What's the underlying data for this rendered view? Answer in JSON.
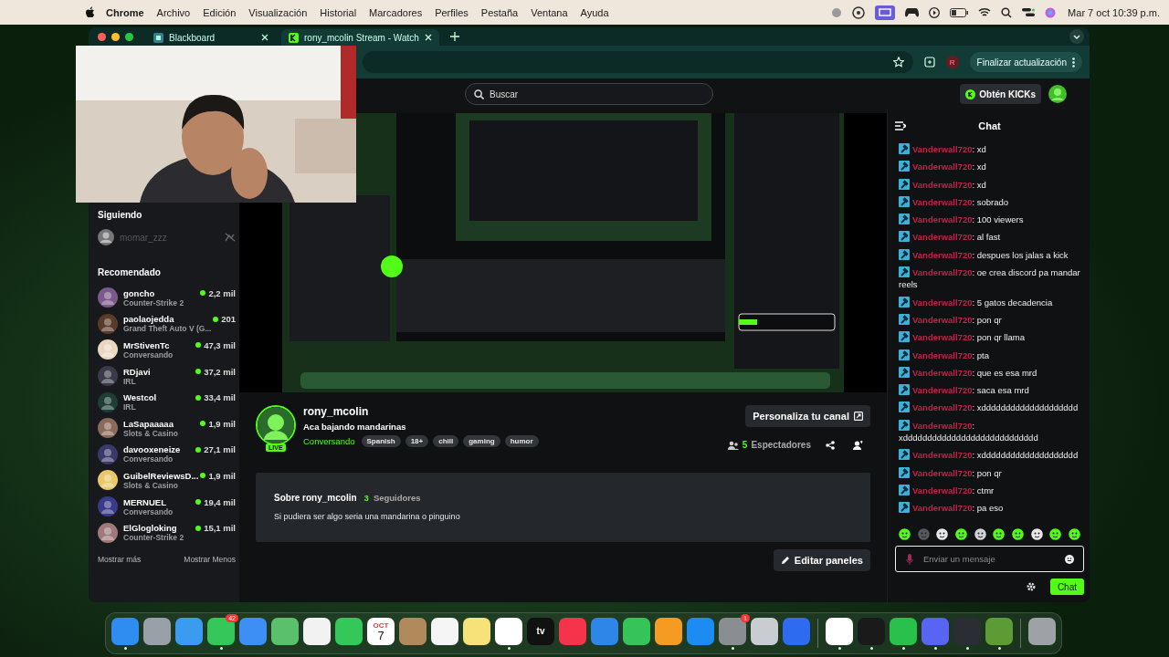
{
  "menu_bar": {
    "app": "Chrome",
    "menus": [
      "Archivo",
      "Edición",
      "Visualización",
      "Historial",
      "Marcadores",
      "Perfiles",
      "Pestaña",
      "Ventana",
      "Ayuda"
    ],
    "clock": "Mar 7 oct 10:39 p.m."
  },
  "browser": {
    "tabs": [
      {
        "title": "Blackboard",
        "selected": false
      },
      {
        "title": "rony_mcolin Stream - Watch",
        "selected": true
      }
    ],
    "profile_initial": "R",
    "update_button": "Finalizar actualización"
  },
  "header": {
    "search": {
      "placeholder": "Buscar"
    },
    "kicks_button": "Obtén KICKs"
  },
  "sidebar": {
    "following_title": "Siguiendo",
    "following": [
      {
        "name": "momar_zzz",
        "live": false
      }
    ],
    "recommended_title": "Recomendado",
    "recommended": [
      {
        "name": "goncho",
        "category": "Counter-Strike 2",
        "viewers": "2,2 mil"
      },
      {
        "name": "paolaojedda",
        "category": "Grand Theft Auto V (G...",
        "viewers": "201"
      },
      {
        "name": "MrStivenTc",
        "category": "Conversando",
        "viewers": "47,3 mil"
      },
      {
        "name": "RDjavi",
        "category": "IRL",
        "viewers": "37,2 mil"
      },
      {
        "name": "Westcol",
        "category": "IRL",
        "viewers": "33,4 mil"
      },
      {
        "name": "LaSapaaaaa",
        "category": "Slots & Casino",
        "viewers": "1,9 mil"
      },
      {
        "name": "davooxeneize",
        "category": "Conversando",
        "viewers": "27,1 mil"
      },
      {
        "name": "GuibelReviewsD...",
        "category": "Slots & Casino",
        "viewers": "1,9 mil"
      },
      {
        "name": "MERNUEL",
        "category": "Conversando",
        "viewers": "19,4 mil"
      },
      {
        "name": "ElGlogloking",
        "category": "Counter-Strike 2",
        "viewers": "15,1 mil"
      }
    ],
    "show_more": "Mostrar más",
    "show_less": "Mostrar Menos"
  },
  "stream": {
    "live_badge": "LIVE",
    "channel": "rony_mcolin",
    "title": "Aca bajando mandarinas",
    "category": "Conversando",
    "tags": [
      "Spanish",
      "18+",
      "chill",
      "gaming",
      "humor"
    ],
    "customize_button": "Personaliza tu canal",
    "viewer_count": "5",
    "viewer_label": "Espectadores"
  },
  "about": {
    "title": "Sobre rony_mcolin",
    "follower_count": "3",
    "follower_label": "Seguidores",
    "bio": "Si pudiera ser algo seria una mandarina o pinguino",
    "edit_button": "Editar paneles"
  },
  "chat": {
    "title": "Chat",
    "messages": [
      {
        "user": "Vanderwall720",
        "text": ": xd"
      },
      {
        "user": "Vanderwall720",
        "text": ": xd"
      },
      {
        "user": "Vanderwall720",
        "text": ": xd"
      },
      {
        "user": "Vanderwall720",
        "text": ": sobrado"
      },
      {
        "user": "Vanderwall720",
        "text": ": 100 viewers"
      },
      {
        "user": "Vanderwall720",
        "text": ": al fast"
      },
      {
        "user": "Vanderwall720",
        "text": ": despues los jalas a kick"
      },
      {
        "user": "Vanderwall720",
        "text": ": oe crea discord pa mandar reels"
      },
      {
        "user": "Vanderwall720",
        "text": ": 5 gatos decadencia"
      },
      {
        "user": "Vanderwall720",
        "text": ": pon qr"
      },
      {
        "user": "Vanderwall720",
        "text": ": pon qr llama"
      },
      {
        "user": "Vanderwall720",
        "text": ": pta"
      },
      {
        "user": "Vanderwall720",
        "text": ": que es esa mrd"
      },
      {
        "user": "Vanderwall720",
        "text": ": saca esa mrd"
      },
      {
        "user": "Vanderwall720",
        "text": ": xdddddddddddddddddddd"
      },
      {
        "user": "Vanderwall720",
        "text": ": xdddddddddddddddddddddddddddd"
      },
      {
        "user": "Vanderwall720",
        "text": ": xdddddddddddddddddddd"
      },
      {
        "user": "Vanderwall720",
        "text": ": pon qr"
      },
      {
        "user": "Vanderwall720",
        "text": ": ctmr"
      },
      {
        "user": "Vanderwall720",
        "text": ": pa eso"
      }
    ],
    "emotes": [
      {
        "color": "#53fc18"
      },
      {
        "color": "#55585e"
      },
      {
        "color": "#e8e8e8"
      },
      {
        "color": "#53fc18"
      },
      {
        "color": "#cfd3d6"
      },
      {
        "color": "#53fc18"
      },
      {
        "color": "#53fc18"
      },
      {
        "color": "#e8e8e8"
      },
      {
        "color": "#53fc18"
      },
      {
        "color": "#53fc18"
      }
    ],
    "input": {
      "placeholder": "Enviar un mensaje"
    },
    "send_button": "Chat"
  },
  "dock": {
    "sections": [
      [
        {
          "color": "#2f8cf0",
          "running": true
        },
        {
          "color": "#9aa0a8",
          "running": false
        },
        {
          "color": "#3a9bf0",
          "running": false
        },
        {
          "color": "#35c759",
          "running": true,
          "badge": "42"
        },
        {
          "color": "#3d8ef5",
          "running": false
        },
        {
          "color": "#5bc06b",
          "running": false
        },
        {
          "color": "#f2f2f2",
          "running": false
        },
        {
          "color": "#34c759",
          "running": false
        },
        {
          "color": "#ffffff",
          "running": false,
          "month": "OCT",
          "day": "7"
        },
        {
          "color": "#b08a5a",
          "running": false
        },
        {
          "color": "#f5f5f5",
          "running": false
        },
        {
          "color": "#f7e27a",
          "running": false
        },
        {
          "color": "#ffffff",
          "running": true
        },
        {
          "color": "#111111",
          "running": false,
          "label": "tv"
        },
        {
          "color": "#f5334a",
          "running": false
        },
        {
          "color": "#2d86e8",
          "running": false
        },
        {
          "color": "#36c35a",
          "running": false
        },
        {
          "color": "#f59b22",
          "running": false
        },
        {
          "color": "#1c8cf2",
          "running": false
        },
        {
          "color": "#8a8d92",
          "running": true,
          "badge": "1"
        },
        {
          "color": "#c9ccd0",
          "running": false
        },
        {
          "color": "#2f6bf0",
          "running": false
        }
      ],
      [
        {
          "color": "#ffffff",
          "running": true
        },
        {
          "color": "#1a1a1a",
          "running": true
        },
        {
          "color": "#29c14b",
          "running": true
        },
        {
          "color": "#5865f2",
          "running": true
        },
        {
          "color": "#2a2d33",
          "running": true
        },
        {
          "color": "#5d9b34",
          "running": true
        }
      ],
      [
        {
          "color": "#9ea2a6",
          "running": false
        }
      ]
    ]
  }
}
